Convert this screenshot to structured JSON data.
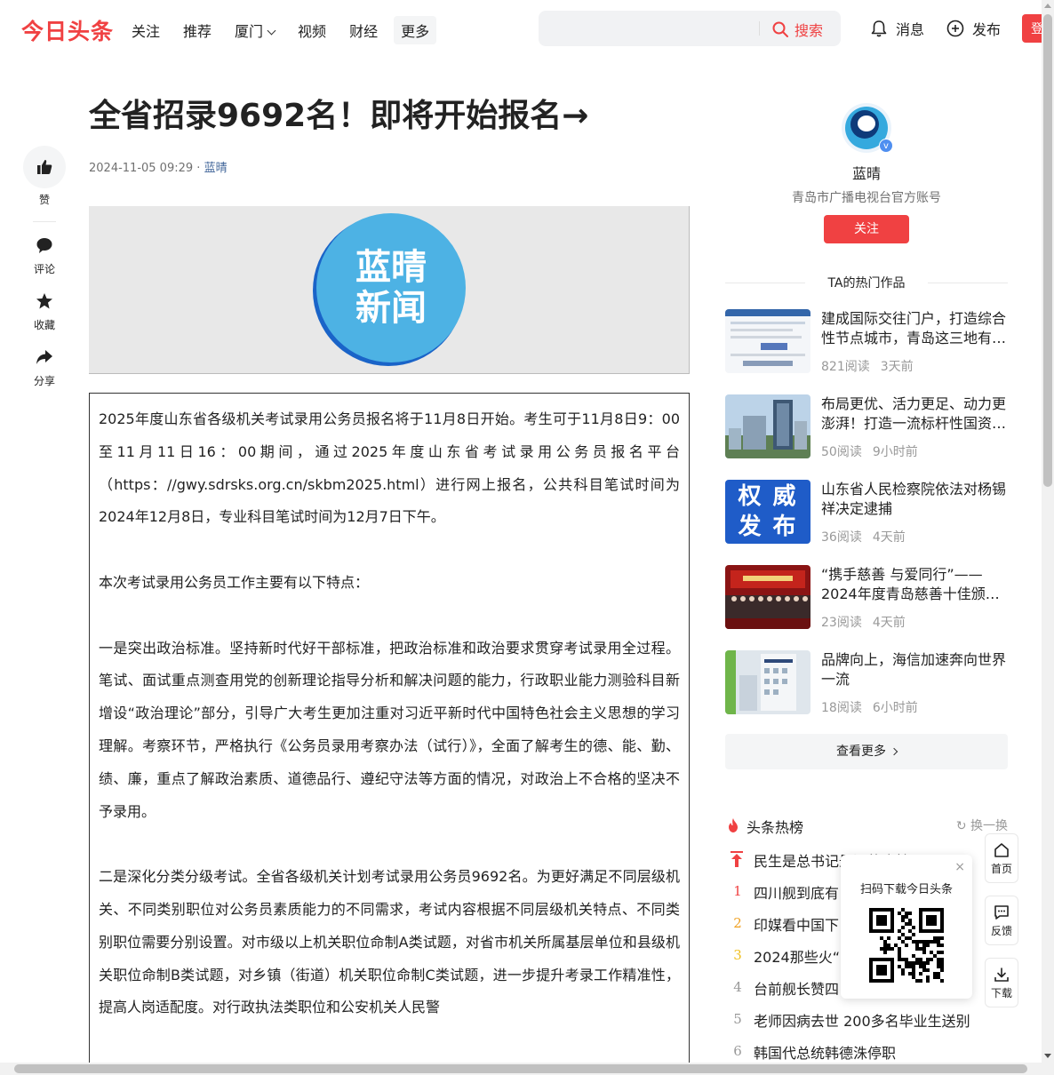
{
  "topbar": {
    "logo": "今日头条",
    "nav": [
      "关注",
      "推荐",
      "厦门",
      "视频",
      "财经",
      "更多"
    ],
    "search": {
      "placeholder": "",
      "button": "搜索"
    },
    "messages": "消息",
    "publish": "发布",
    "login": "登"
  },
  "side_tools": {
    "like": "赞",
    "comment": "评论",
    "collect": "收藏",
    "share": "分享"
  },
  "article": {
    "title": "全省招录9692名！即将开始报名→",
    "date": "2024-11-05 09:29",
    "separator": "·",
    "author": "蓝晴",
    "hero_text_line1": "蓝晴",
    "hero_text_line2": "新闻",
    "paragraphs": [
      "2025年度山东省各级机关考试录用公务员报名将于11月8日开始。考生可于11月8日9：00至11月11日16：00期间，通过2025年度山东省考试录用公务员报名平台（https：//gwy.sdrsks.org.cn/skbm2025.html）进行网上报名，公共科目笔试时间为2024年12月8日，专业科目笔试时间为12月7日下午。",
      "本次考试录用公务员工作主要有以下特点：",
      "一是突出政治标准。坚持新时代好干部标准，把政治标准和政治要求贯穿考试录用全过程。笔试、面试重点测查用党的创新理论指导分析和解决问题的能力，行政职业能力测验科目新增设“政治理论”部分，引导广大考生更加注重对习近平新时代中国特色社会主义思想的学习理解。考察环节，严格执行《公务员录用考察办法（试行）》，全面了解考生的德、能、勤、绩、廉，重点了解政治素质、道德品行、遵纪守法等方面的情况，对政治上不合格的坚决不予录用。",
      "二是深化分类分级考试。全省各级机关计划考试录用公务员9692名。为更好满足不同层级机关、不同类别职位对公务员素质能力的不同需求，考试内容根据不同层级机关特点、不同类别职位需要分别设置。对市级以上机关职位命制A类试题，对省市机关所属基层单位和县级机关职位命制B类试题，对乡镇（街道）机关职位命制C类试题，进一步提升考录工作精准性，提高人岗适配度。对行政执法类职位和公安机关人民警"
    ]
  },
  "author_card": {
    "name": "蓝晴",
    "desc": "青岛市广播电视台官方账号",
    "follow": "关注",
    "verified": "v"
  },
  "hot_works": {
    "heading": "TA的热门作品",
    "items": [
      {
        "title": "建成国际交往门户，打造综合性节点城市，青岛这三地有…",
        "reads": "821阅读",
        "time": "3天前"
      },
      {
        "title": "布局更优、活力更足、动力更澎湃！打造一流标杆性国资…",
        "reads": "50阅读",
        "time": "9小时前"
      },
      {
        "title": "山东省人民检察院依法对杨锡祥决定逮捕",
        "reads": "36阅读",
        "time": "4天前"
      },
      {
        "title": "“携手慈善 与爱同行”——2024年度青岛慈善十佳颁…",
        "reads": "23阅读",
        "time": "4天前"
      },
      {
        "title": "品牌向上，海信加速奔向世界一流",
        "reads": "18阅读",
        "time": "6小时前"
      }
    ],
    "thumb3_text": "权 威 发 布",
    "see_more": "查看更多"
  },
  "hot_board": {
    "title": "头条热榜",
    "refresh": "换一换",
    "items": [
      {
        "rank": "",
        "text": "民生是总书记最深的牵挂"
      },
      {
        "rank": "1",
        "text": "四川舰到底有"
      },
      {
        "rank": "2",
        "text": "印媒看中国下"
      },
      {
        "rank": "3",
        "text": "2024那些火“出"
      },
      {
        "rank": "4",
        "text": "台前舰长赞四"
      },
      {
        "rank": "5",
        "text": "老师因病去世 200多名毕业生送别"
      },
      {
        "rank": "6",
        "text": "韩国代总统韩德洙停职"
      }
    ]
  },
  "qr_popup": {
    "title": "扫码下载今日头条",
    "close": "×"
  },
  "float_buttons": {
    "home": "首页",
    "feedback": "反馈",
    "download": "下载"
  },
  "colors": {
    "brand_red": "#f04142",
    "hero_blue": "#4db2e4",
    "hot_rank_1": "#f04142",
    "hot_rank_2": "#f0a020",
    "hot_rank_3": "#f0c020",
    "hot_rank_other": "#999999"
  }
}
